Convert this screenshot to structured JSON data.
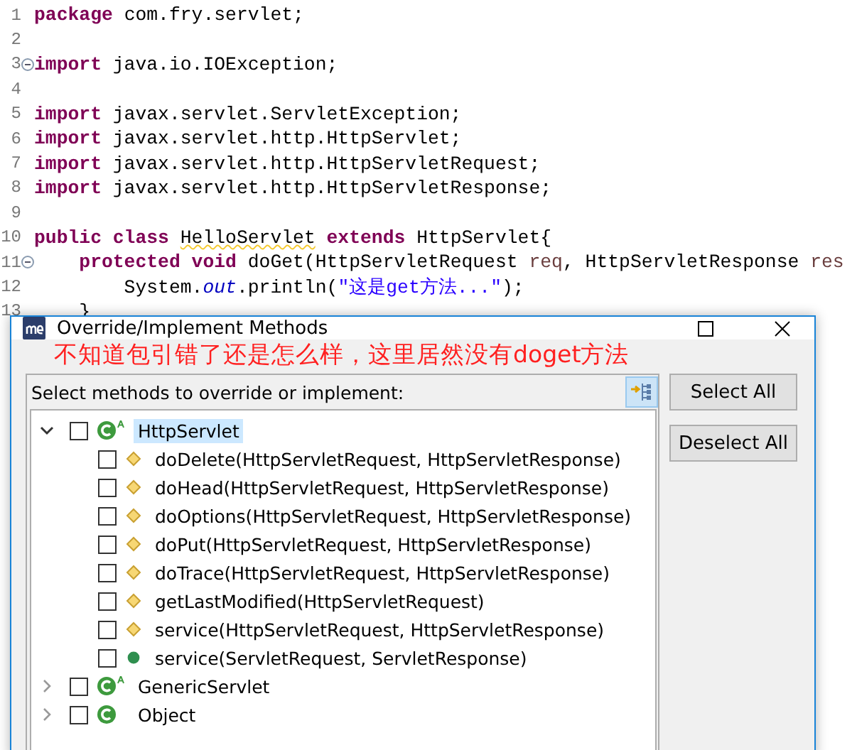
{
  "editor": {
    "lines": [
      {
        "number": "1",
        "fold": false,
        "tokens": [
          {
            "kind": "keyword",
            "text": "package"
          },
          {
            "kind": "plain",
            "text": " com.fry.servlet;"
          }
        ]
      },
      {
        "number": "2",
        "fold": false
      },
      {
        "number": "3",
        "fold": true,
        "tokens": [
          {
            "kind": "keyword",
            "text": "import"
          },
          {
            "kind": "plain",
            "text": " java.io.IOException;"
          }
        ]
      },
      {
        "number": "4",
        "fold": false
      },
      {
        "number": "5",
        "fold": false,
        "tokens": [
          {
            "kind": "keyword",
            "text": "import"
          },
          {
            "kind": "plain",
            "text": " javax.servlet.ServletException;"
          }
        ]
      },
      {
        "number": "6",
        "fold": false,
        "tokens": [
          {
            "kind": "keyword",
            "text": "import"
          },
          {
            "kind": "plain",
            "text": " javax.servlet.http.HttpServlet;"
          }
        ]
      },
      {
        "number": "7",
        "fold": false,
        "tokens": [
          {
            "kind": "keyword",
            "text": "import"
          },
          {
            "kind": "plain",
            "text": " javax.servlet.http.HttpServletRequest;"
          }
        ]
      },
      {
        "number": "8",
        "fold": false,
        "tokens": [
          {
            "kind": "keyword",
            "text": "import"
          },
          {
            "kind": "plain",
            "text": " javax.servlet.http.HttpServletResponse;"
          }
        ]
      },
      {
        "number": "9",
        "fold": false
      },
      {
        "number": "10",
        "fold": false,
        "tokens": [
          {
            "kind": "keyword",
            "text": "public class "
          },
          {
            "kind": "warning",
            "text": "HelloServlet"
          },
          {
            "kind": "keyword",
            "text": " extends"
          },
          {
            "kind": "plain",
            "text": " HttpServlet{"
          }
        ]
      },
      {
        "number": "11",
        "fold": true,
        "tokens": [
          {
            "kind": "keyword",
            "text": "    protected void"
          },
          {
            "kind": "plain",
            "text": " doGet(HttpServletRequest "
          },
          {
            "kind": "param",
            "text": "req"
          },
          {
            "kind": "plain",
            "text": ", HttpServletResponse "
          },
          {
            "kind": "param",
            "text": "res"
          }
        ]
      },
      {
        "number": "12",
        "fold": false,
        "tokens": [
          {
            "kind": "plain",
            "text": "        System."
          },
          {
            "kind": "field",
            "text": "out"
          },
          {
            "kind": "plain",
            "text": ".println("
          },
          {
            "kind": "string",
            "text": "\"这是get方法...\""
          },
          {
            "kind": "plain",
            "text": ");"
          }
        ]
      },
      {
        "number": "13",
        "fold": false,
        "tokens": [
          {
            "kind": "plain",
            "text": "    }"
          }
        ]
      }
    ]
  },
  "dialog": {
    "title": "Override/Implement Methods",
    "annotation": "不知道包引错了还是怎么样，这里居然没有doget方法",
    "prompt": "Select methods to override or implement:",
    "tree": [
      {
        "label": "HttpServlet",
        "kind": "abstract",
        "checked": false,
        "selected": true,
        "expanded": true,
        "children": [
          {
            "label": "doDelete(HttpServletRequest, HttpServletResponse)",
            "kind": "protected",
            "checked": false,
            "selected": false
          },
          {
            "label": "doHead(HttpServletRequest, HttpServletResponse)",
            "kind": "protected",
            "checked": false,
            "selected": false
          },
          {
            "label": "doOptions(HttpServletRequest, HttpServletResponse)",
            "kind": "protected",
            "checked": false,
            "selected": false
          },
          {
            "label": "doPut(HttpServletRequest, HttpServletResponse)",
            "kind": "protected",
            "checked": false,
            "selected": false
          },
          {
            "label": "doTrace(HttpServletRequest, HttpServletResponse)",
            "kind": "protected",
            "checked": false,
            "selected": false
          },
          {
            "label": "getLastModified(HttpServletRequest)",
            "kind": "protected",
            "checked": false,
            "selected": false
          },
          {
            "label": "service(HttpServletRequest, HttpServletResponse)",
            "kind": "protected",
            "checked": false,
            "selected": false
          },
          {
            "label": "service(ServletRequest, ServletResponse)",
            "kind": "public",
            "checked": false,
            "selected": false
          }
        ]
      },
      {
        "label": "GenericServlet",
        "kind": "abstract",
        "checked": false,
        "selected": false,
        "expanded": false
      },
      {
        "label": "Object",
        "kind": "class",
        "checked": false,
        "selected": false,
        "expanded": false
      }
    ],
    "buttons": [
      "Select All",
      "Deselect All"
    ]
  }
}
